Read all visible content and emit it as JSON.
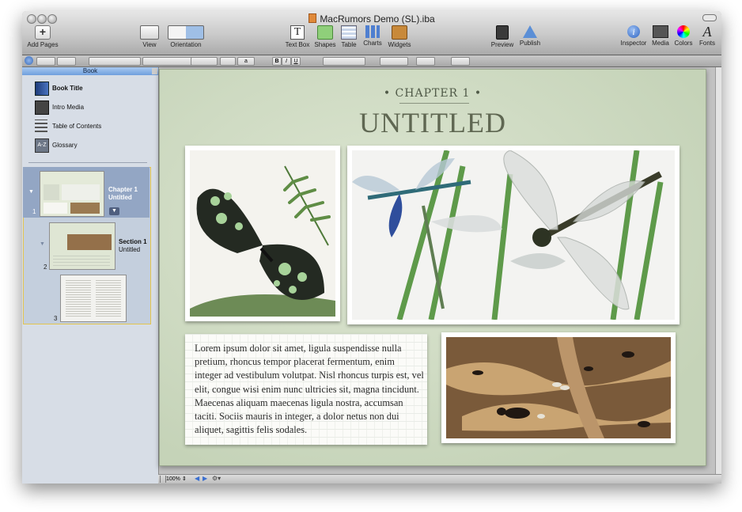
{
  "window": {
    "title": "MacRumors Demo (SL).iba"
  },
  "toolbar": {
    "add_pages": "Add Pages",
    "view": "View",
    "orientation": "Orientation",
    "text_box": "Text Box",
    "shapes": "Shapes",
    "table": "Table",
    "charts": "Charts",
    "widgets": "Widgets",
    "preview": "Preview",
    "publish": "Publish",
    "inspector": "Inspector",
    "media": "Media",
    "colors": "Colors",
    "fonts": "Fonts"
  },
  "formatbar": {
    "bold": "B",
    "italic": "I",
    "underline": "U",
    "font_size_field": "a"
  },
  "sidebar": {
    "tab": "Book",
    "items": [
      {
        "label": "Book Title",
        "icon": "book-icon"
      },
      {
        "label": "Intro Media",
        "icon": "film-icon"
      },
      {
        "label": "Table of Contents",
        "icon": "list-icon"
      },
      {
        "label": "Glossary",
        "icon": "az-icon"
      }
    ],
    "pages": [
      {
        "num": "1",
        "line1": "Chapter 1",
        "line2": "Untitled"
      },
      {
        "num": "2",
        "line1": "Section 1",
        "line2": "Untitled"
      },
      {
        "num": "3"
      }
    ]
  },
  "page": {
    "chapter_label": "• CHAPTER 1 •",
    "title": "UNTITLED",
    "body": "Lorem ipsum dolor sit amet, ligula suspendisse nulla pretium, rhoncus tempor placerat fermentum, enim integer ad vestibulum volutpat. Nisl rhoncus turpis est, vel elit, congue wisi enim nunc ultricies sit, magna tincidunt. Maecenas aliquam maecenas ligula nostra, accumsan taciti. Sociis mauris in integer, a dolor netus non dui aliquet, sagittis felis sodales."
  },
  "status": {
    "zoom": "100%"
  },
  "colors": {
    "accent": "#6f9fdd",
    "selection_border": "#e3c44e",
    "page_bg": "#cfdbc3"
  }
}
